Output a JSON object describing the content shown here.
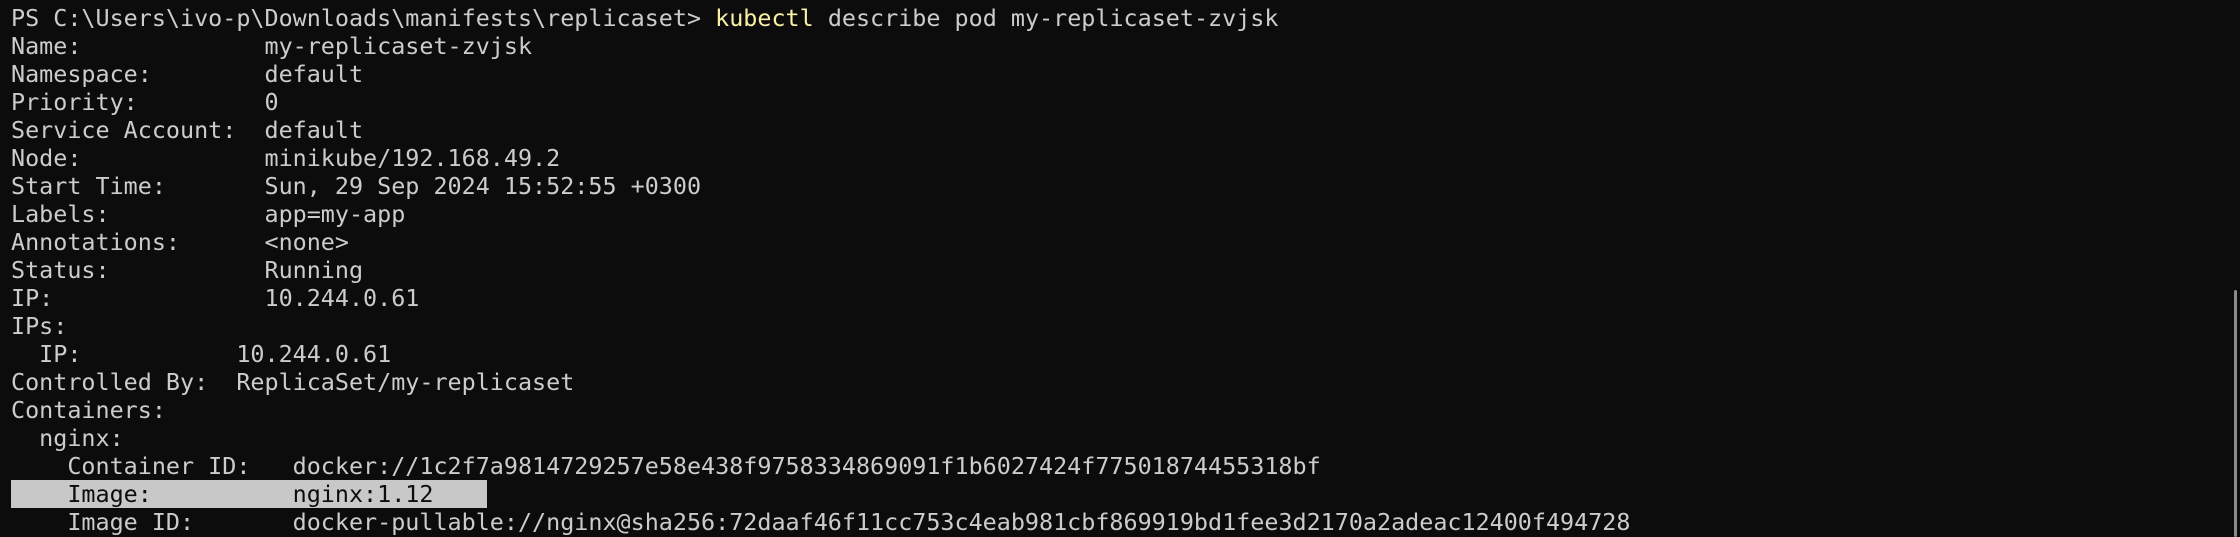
{
  "prompt": {
    "path": "PS C:\\Users\\ivo-p\\Downloads\\manifests\\replicaset>",
    "command": "kubectl",
    "args": "describe pod my-replicaset-zvjsk"
  },
  "output": {
    "name": "Name:             my-replicaset-zvjsk",
    "namespace": "Namespace:        default",
    "priority": "Priority:         0",
    "service_account": "Service Account:  default",
    "node": "Node:             minikube/192.168.49.2",
    "start_time": "Start Time:       Sun, 29 Sep 2024 15:52:55 +0300",
    "labels": "Labels:           app=my-app",
    "annotations": "Annotations:      <none>",
    "status": "Status:           Running",
    "ip": "IP:               10.244.0.61",
    "ips_header": "IPs:",
    "ips_ip": "  IP:           10.244.0.61",
    "controlled_by": "Controlled By:  ReplicaSet/my-replicaset",
    "containers": "Containers:",
    "nginx": "  nginx:",
    "container_id": "    Container ID:   docker://1c2f7a9814729257e58e438f9758334869091f1b6027424f77501874455318bf",
    "image": "    Image:          nginx:1.12",
    "image_id": "    Image ID:       docker-pullable://nginx@sha256:72daaf46f11cc753c4eab981cbf869919bd1fee3d2170a2adeac12400f494728"
  },
  "colors": {
    "background": "#0c0c0c",
    "text": "#cccccc",
    "command": "#f9f1a5",
    "selection": "#c8c8c8"
  }
}
